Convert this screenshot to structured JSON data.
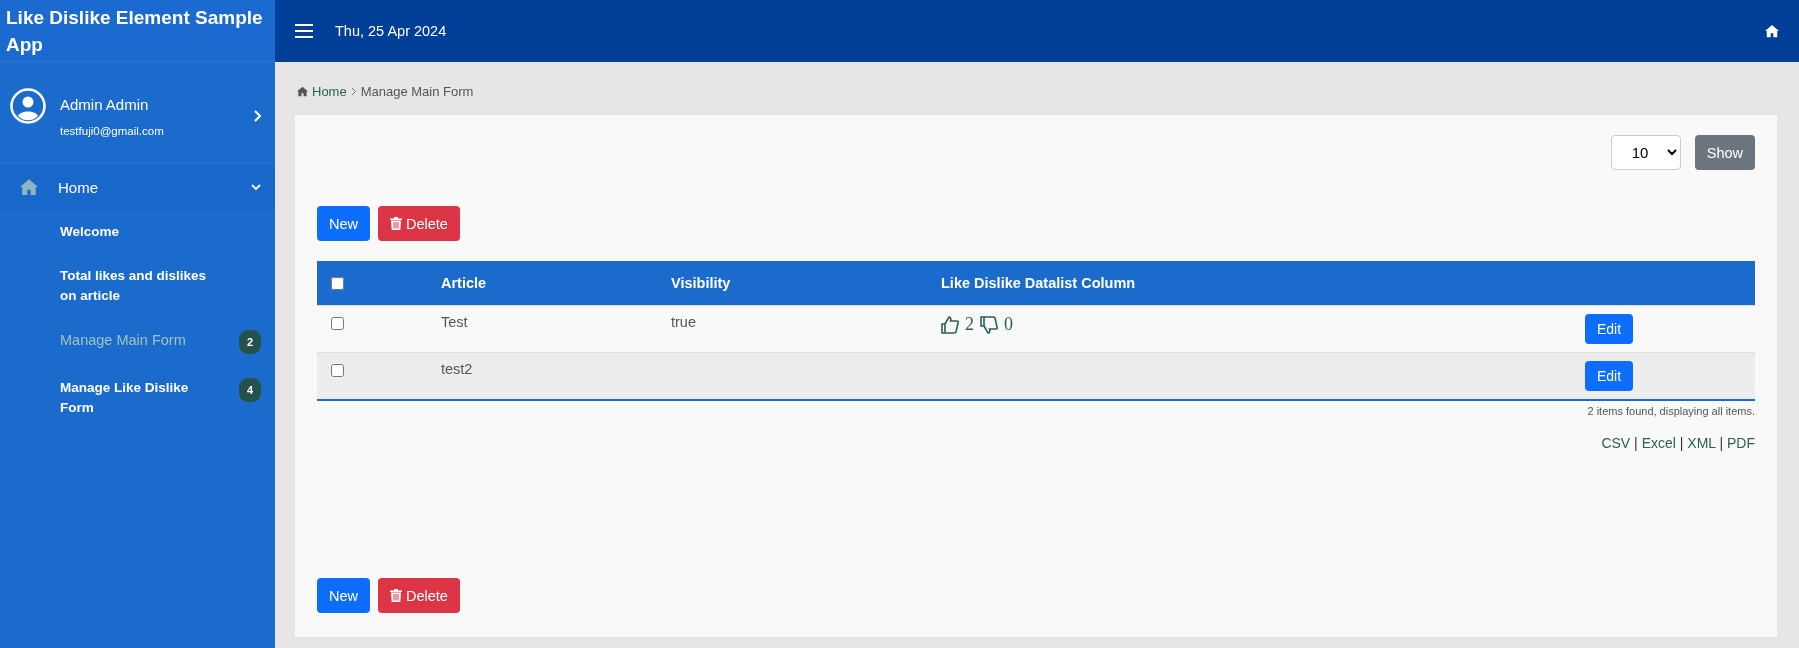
{
  "app_title": "Like Dislike Element Sample App",
  "header": {
    "date": "Thu, 25 Apr 2024"
  },
  "user": {
    "name": "Admin Admin",
    "email": "testfuji0@gmail.com"
  },
  "sidebar": {
    "items": [
      {
        "label": "Home",
        "expanded": true,
        "children": [
          {
            "label": "Welcome",
            "selected": false
          },
          {
            "label": "Total likes and dislikes on article",
            "selected": false
          },
          {
            "label": "Manage Main Form",
            "selected": true,
            "badge": "2"
          },
          {
            "label": "Manage Like Dislike Form",
            "selected": false,
            "badge": "4"
          }
        ]
      }
    ]
  },
  "breadcrumb": {
    "home": "Home",
    "current": "Manage Main Form"
  },
  "page_size": {
    "value": "10",
    "button": "Show"
  },
  "actions": {
    "new": "New",
    "delete": "Delete"
  },
  "table": {
    "columns": [
      "Article",
      "Visibility",
      "Like Dislike Datalist Column"
    ],
    "header_checked": false,
    "rows": [
      {
        "checked": false,
        "article": "Test",
        "visibility": "true",
        "likes": "2",
        "dislikes": "0",
        "action": "Edit"
      },
      {
        "checked": false,
        "article": "test2",
        "action": "Edit"
      }
    ]
  },
  "summary": "2 items found, displaying all items.",
  "exports": [
    "CSV",
    "Excel",
    "XML",
    "PDF"
  ],
  "export_separator": "|",
  "bottom_actions": {
    "new": "New",
    "delete": "Delete"
  }
}
